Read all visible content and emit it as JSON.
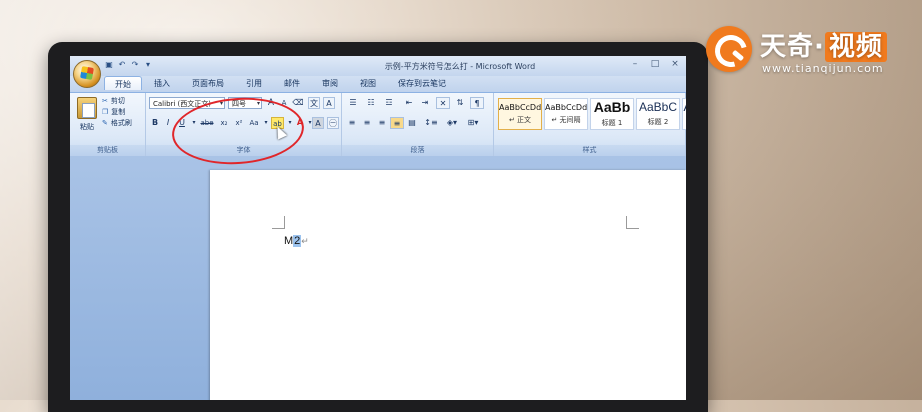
{
  "window": {
    "title": "示例-平方米符号怎么打 - Microsoft Word",
    "controls": [
      "–",
      "□",
      "×"
    ]
  },
  "quick_access": [
    "save-icon",
    "undo-icon",
    "redo-icon"
  ],
  "tabs": [
    {
      "label": "开始",
      "active": true
    },
    {
      "label": "插入",
      "active": false
    },
    {
      "label": "页面布局",
      "active": false
    },
    {
      "label": "引用",
      "active": false
    },
    {
      "label": "邮件",
      "active": false
    },
    {
      "label": "审阅",
      "active": false
    },
    {
      "label": "视图",
      "active": false
    },
    {
      "label": "保存到云笔记",
      "active": false
    }
  ],
  "clipboard": {
    "paste": "粘贴",
    "cut": "剪切",
    "copy": "复制",
    "format_painter": "格式刷",
    "group_label": "剪贴板"
  },
  "font": {
    "font_name": "Calibri (西文正文)",
    "font_size": "四号",
    "group_label": "字体",
    "buttons": {
      "grow": "A",
      "shrink": "A",
      "clear": "⌫",
      "phonetic": "文",
      "char_border": "A",
      "bold": "B",
      "italic": "I",
      "underline": "U",
      "strike": "abe",
      "subscript": "x₂",
      "superscript": "x²",
      "change_case": "Aa",
      "highlight": "ab",
      "font_color": "A",
      "char_shading": "A",
      "enclose": "㊀"
    }
  },
  "paragraph": {
    "group_label": "段落"
  },
  "styles": {
    "group_label": "样式",
    "items": [
      {
        "sample": "AaBbCcDd",
        "name": "↵ 正文",
        "selected": true
      },
      {
        "sample": "AaBbCcDd",
        "name": "↵ 无间隔",
        "selected": false
      },
      {
        "sample": "AaBb",
        "name": "标题 1",
        "selected": false
      },
      {
        "sample": "AaBbC",
        "name": "标题 2",
        "selected": false
      }
    ]
  },
  "document": {
    "text": "M",
    "selected_char": "2",
    "paragraph_mark": "↵"
  },
  "watermark": {
    "title_left": "天奇·",
    "title_right": "视频",
    "url": "www.tianqijun.com"
  },
  "colors": {
    "annotation": "#e0262a",
    "watermark_orange": "#f07a1e",
    "ribbon_blue": "#dce8f7"
  }
}
